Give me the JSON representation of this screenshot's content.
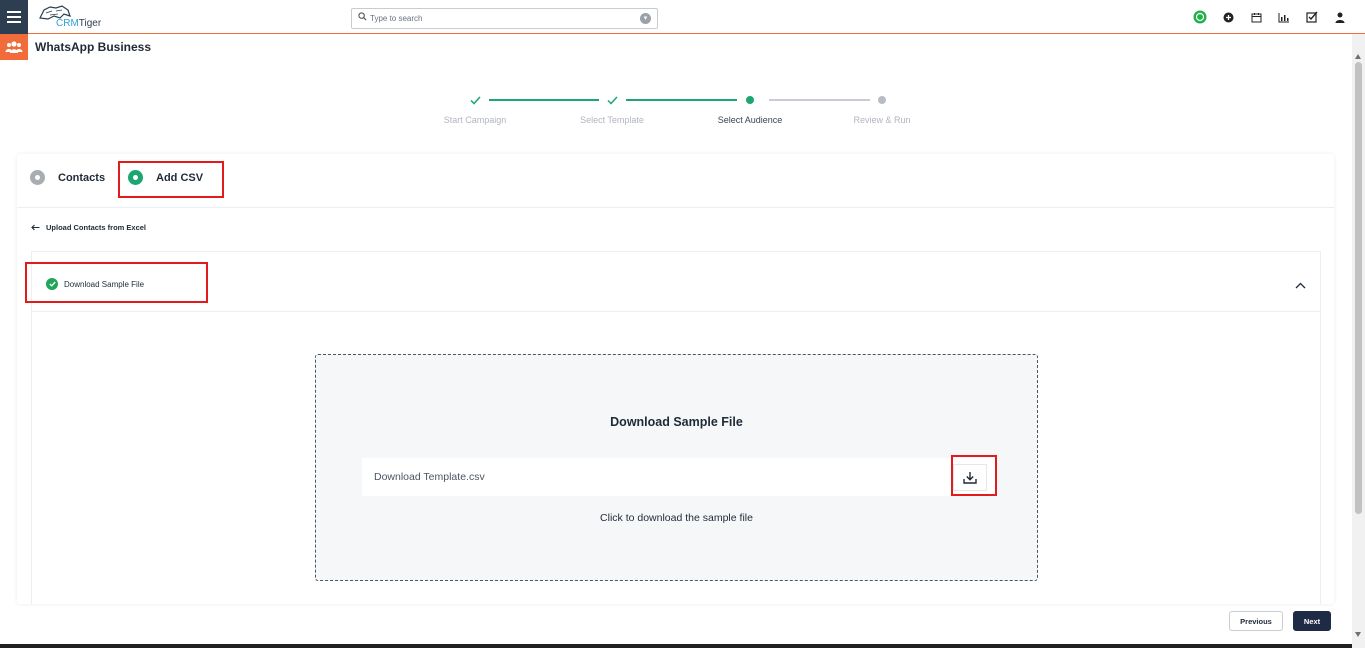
{
  "app": {
    "logo_prefix": "CRM",
    "logo_suffix": "Tiger",
    "module_title": "WhatsApp Business"
  },
  "search": {
    "placeholder": "Type to search",
    "value": ""
  },
  "header_icons": [
    "whatsapp-icon",
    "add-icon",
    "calendar-icon",
    "chart-icon",
    "tasks-icon",
    "user-icon"
  ],
  "stepper": {
    "steps": [
      {
        "label": "Start Campaign",
        "state": "done"
      },
      {
        "label": "Select Template",
        "state": "done"
      },
      {
        "label": "Select Audience",
        "state": "current"
      },
      {
        "label": "Review & Run",
        "state": "upcoming"
      }
    ]
  },
  "audience": {
    "options": [
      {
        "label": "Contacts",
        "selected": false
      },
      {
        "label": "Add CSV",
        "selected": true
      }
    ],
    "back_link": "Upload Contacts from Excel",
    "section_title": "Download Sample File",
    "dropzone": {
      "title": "Download Sample File",
      "file_name": "Download Template.csv",
      "caption": "Click to download the sample file"
    }
  },
  "footer": {
    "previous_label": "Previous",
    "next_label": "Next"
  },
  "colors": {
    "accent_green": "#1ea672",
    "brand_orange": "#f26b3a",
    "nav_dark": "#2d3e50",
    "highlight_red": "#e31b1b",
    "next_button": "#1f2a44"
  }
}
